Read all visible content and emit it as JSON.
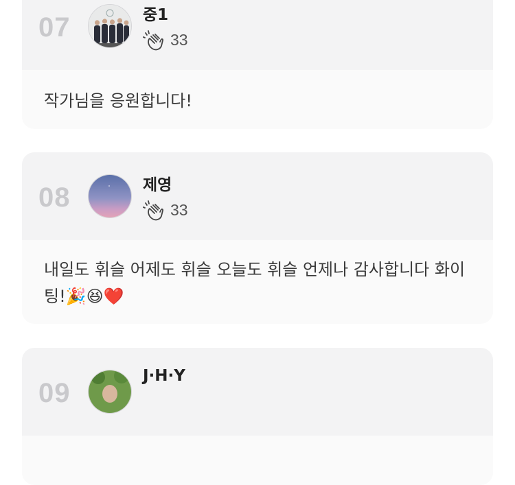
{
  "comments": [
    {
      "rank": "07",
      "author": "중1",
      "claps": "33",
      "text": "작가님을 응원합니다!",
      "avatar_icon": "group-photo-avatar"
    },
    {
      "rank": "08",
      "author": "제영",
      "claps": "33",
      "text": "내일도 휘슬 어제도 휘슬 오늘도 휘슬 언제나 감사합니다 화이팅!🎉😆❤️",
      "avatar_icon": "dusk-sky-avatar"
    },
    {
      "rank": "09",
      "author": "J·H·Y",
      "claps": "",
      "text": "",
      "avatar_icon": "green-nature-avatar"
    }
  ],
  "icons": {
    "clap": "clapping-hands-icon"
  },
  "colors": {
    "rank": "#c9c9cc",
    "card_head": "#f3f3f4",
    "card_body": "#fafafa"
  }
}
